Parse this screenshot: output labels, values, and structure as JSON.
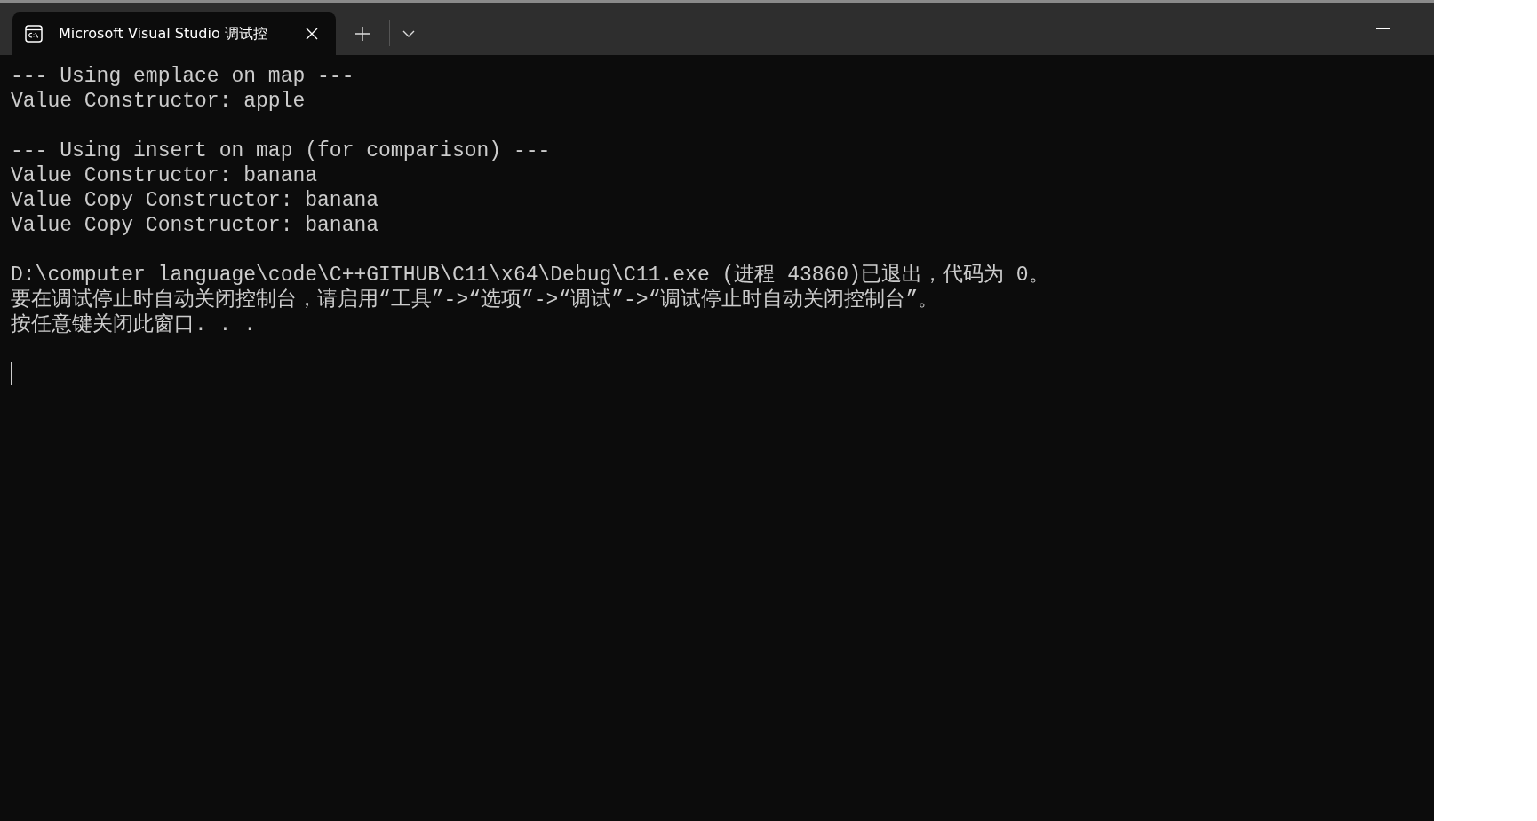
{
  "tab": {
    "title": "Microsoft Visual Studio 调试控",
    "selected": true
  },
  "console": {
    "blocks": [
      [
        "--- Using emplace on map ---",
        "Value Constructor: apple"
      ],
      [
        "--- Using insert on map (for comparison) ---",
        "Value Constructor: banana",
        "Value Copy Constructor: banana",
        "Value Copy Constructor: banana"
      ],
      [
        "D:\\computer language\\code\\C++GITHUB\\C11\\x64\\Debug\\C11.exe (进程 43860)已退出，代码为 0。",
        "要在调试停止时自动关闭控制台，请启用“工具”->“选项”->“调试”->“调试停止时自动关闭控制台”。",
        "按任意键关闭此窗口. . ."
      ]
    ],
    "cursor": true
  }
}
